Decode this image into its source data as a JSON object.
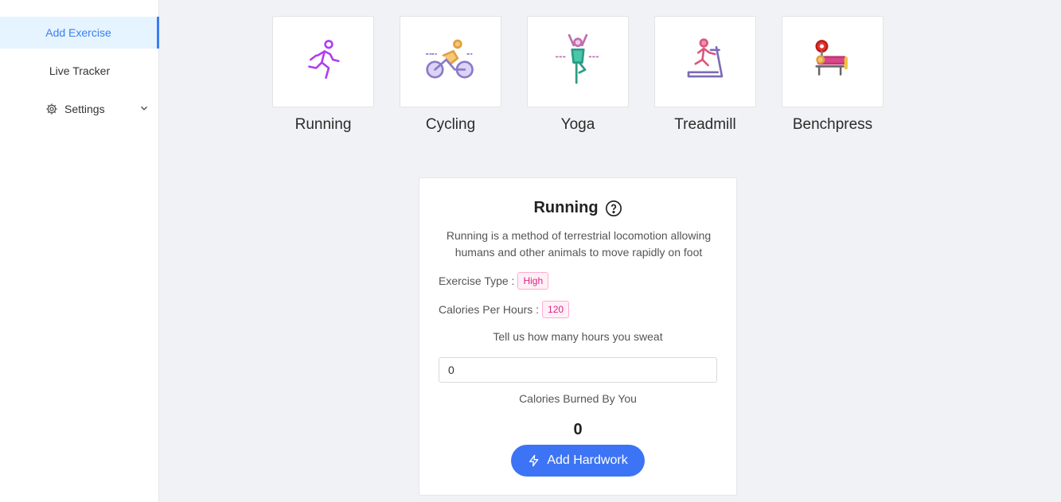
{
  "sidebar": {
    "items": [
      {
        "label": "Add Exercise",
        "active": true
      },
      {
        "label": "Live Tracker"
      },
      {
        "label": "Settings",
        "icon": "gear-icon",
        "expand_icon": "chevron-down-icon"
      }
    ]
  },
  "exercises": [
    {
      "label": "Running",
      "icon": "running-icon"
    },
    {
      "label": "Cycling",
      "icon": "cycling-icon"
    },
    {
      "label": "Yoga",
      "icon": "yoga-icon"
    },
    {
      "label": "Treadmill",
      "icon": "treadmill-icon"
    },
    {
      "label": "Benchpress",
      "icon": "benchpress-icon"
    }
  ],
  "detail": {
    "title": "Running",
    "help_icon": "question-circle-icon",
    "description": "Running is a method of terrestrial locomotion allowing humans and other animals to move rapidly on foot",
    "exercise_type_label": "Exercise Type :",
    "exercise_type_value": "High",
    "calories_label": "Calories Per Hours :",
    "calories_value": "120",
    "hours_prompt": "Tell us how many hours you sweat",
    "hours_value": "0",
    "burned_label": "Calories Burned By You",
    "burned_value": "0",
    "add_button": "Add Hardwork",
    "add_button_icon": "lightning-icon"
  },
  "colors": {
    "accent": "#3d74f5",
    "active_menu_bg": "#e6f4ff",
    "tag_text": "#e0218a",
    "background": "#f0f2f5"
  }
}
